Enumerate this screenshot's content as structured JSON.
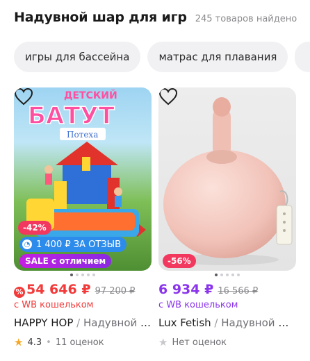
{
  "header": {
    "title": "Надувной шар для игр",
    "count": "245 товаров найдено"
  },
  "chips": [
    {
      "label": "игры для бассейна"
    },
    {
      "label": "матрас для плавания"
    }
  ],
  "products": [
    {
      "image_text_line1": "ДЕТСКИЙ",
      "image_text_line2": "БАТУТ",
      "image_text_line3": "Потеха",
      "discount": "-42%",
      "review_bonus": "1 400 ₽ ЗА ОТЗЫВ",
      "sale_label": "SALE с отличием",
      "price": "54 646 ₽",
      "old_price": "97 200 ₽",
      "wallet_label": "с WB кошельком",
      "brand": "HAPPY HOP",
      "separator": " / ",
      "description": "Надувной батут",
      "rating": "4.3",
      "reviews": "11 оценок",
      "image_dots": 5,
      "active_dot": 0
    },
    {
      "discount": "-56%",
      "price": "6 934 ₽",
      "old_price": "16 566 ₽",
      "wallet_label": "с WB кошельком",
      "brand": "Lux Fetish",
      "separator": " / ",
      "description": "Надувной шар",
      "reviews": "Нет оценок",
      "image_dots": 5,
      "active_dot": 0
    }
  ],
  "colors": {
    "accent_red": "#f23a3a",
    "accent_purple": "#8a35ec",
    "discount_pink": "#f3385f",
    "review_blue": "#2d8ceb"
  }
}
